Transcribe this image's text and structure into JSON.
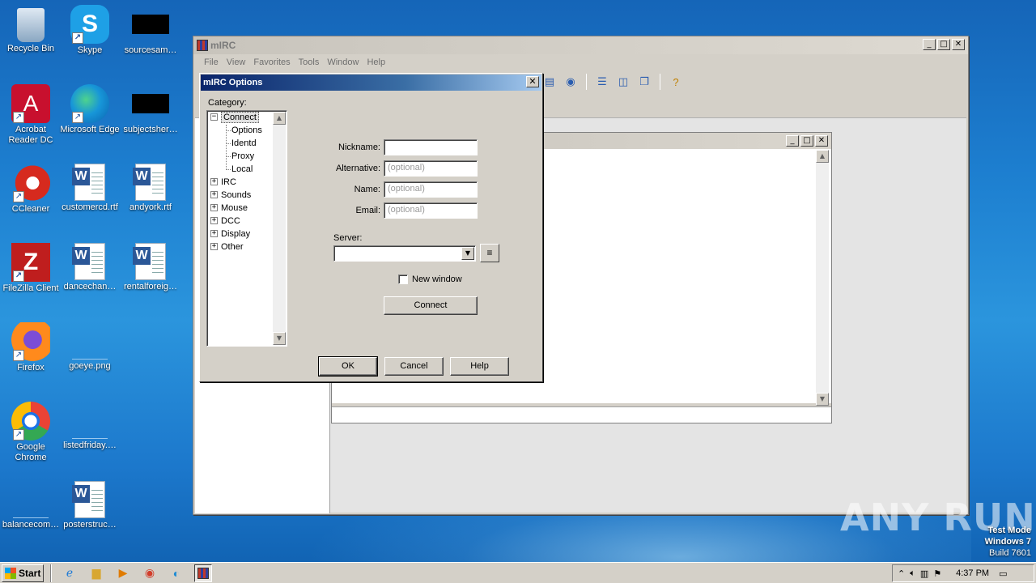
{
  "desktop": {
    "icons": [
      {
        "label": "Recycle Bin",
        "icon": "recycle-bin-icon"
      },
      {
        "label": "Skype",
        "icon": "skype-icon"
      },
      {
        "label": "sourcesam…",
        "icon": "black-thumbnail-icon"
      },
      {
        "label": "Acrobat Reader DC",
        "icon": "acrobat-icon"
      },
      {
        "label": "Microsoft Edge",
        "icon": "edge-icon"
      },
      {
        "label": "subjectsher…",
        "icon": "black-thumbnail-icon"
      },
      {
        "label": "CCleaner",
        "icon": "ccleaner-icon"
      },
      {
        "label": "customercd.rtf",
        "icon": "word-doc-icon"
      },
      {
        "label": "andyork.rtf",
        "icon": "word-doc-icon"
      },
      {
        "label": "FileZilla Client",
        "icon": "filezilla-icon"
      },
      {
        "label": "dancechan…",
        "icon": "word-doc-icon"
      },
      {
        "label": "rentalforeig…",
        "icon": "word-doc-icon"
      },
      {
        "label": "Firefox",
        "icon": "firefox-icon"
      },
      {
        "label": "goeye.png",
        "icon": "blank-file-icon"
      },
      {
        "label": "Google Chrome",
        "icon": "chrome-icon"
      },
      {
        "label": "listedfriday.…",
        "icon": "blank-file-icon"
      },
      {
        "label": "balancecom…",
        "icon": "blank-file-icon"
      },
      {
        "label": "posterstruc…",
        "icon": "word-doc-icon"
      }
    ]
  },
  "mirc": {
    "title": "mIRC",
    "menu": [
      "File",
      "View",
      "Favorites",
      "Tools",
      "Window",
      "Help"
    ]
  },
  "options_dialog": {
    "title": "mIRC Options",
    "category_label": "Category:",
    "tree": {
      "connect": "Connect",
      "connect_children": [
        "Options",
        "Identd",
        "Proxy",
        "Local"
      ],
      "others": [
        "IRC",
        "Sounds",
        "Mouse",
        "DCC",
        "Display",
        "Other"
      ]
    },
    "fields": {
      "nickname_label": "Nickname:",
      "nickname_value": "",
      "alternative_label": "Alternative:",
      "alternative_placeholder": "(optional)",
      "name_label": "Name:",
      "name_placeholder": "(optional)",
      "email_label": "Email:",
      "email_placeholder": "(optional)",
      "server_label": "Server:",
      "server_value": ""
    },
    "new_window_label": "New window",
    "new_window_checked": false,
    "connect_button": "Connect",
    "ok_button": "OK",
    "cancel_button": "Cancel",
    "help_button": "Help"
  },
  "taskbar": {
    "start_label": "Start",
    "clock": "4:37 PM"
  },
  "watermark": {
    "line1": "Test Mode",
    "line2": "Windows 7",
    "line3": "Build 7601",
    "brand": "ANY RUN"
  }
}
